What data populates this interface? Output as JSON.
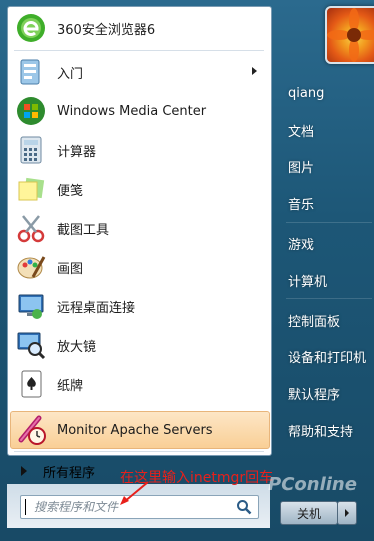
{
  "left_menu": {
    "items": [
      {
        "label": "360安全浏览器6",
        "icon": "browser-360-icon"
      },
      {
        "label": "入门",
        "icon": "getting-started-icon",
        "has_submenu": true
      },
      {
        "label": "Windows Media Center",
        "icon": "windows-media-center-icon"
      },
      {
        "label": "计算器",
        "icon": "calculator-icon"
      },
      {
        "label": "便笺",
        "icon": "sticky-notes-icon"
      },
      {
        "label": "截图工具",
        "icon": "snipping-tool-icon"
      },
      {
        "label": "画图",
        "icon": "paint-icon"
      },
      {
        "label": "远程桌面连接",
        "icon": "remote-desktop-icon"
      },
      {
        "label": "放大镜",
        "icon": "magnifier-icon"
      },
      {
        "label": "纸牌",
        "icon": "solitaire-icon"
      },
      {
        "label": "Monitor Apache Servers",
        "icon": "apache-monitor-icon",
        "highlighted": true
      }
    ],
    "all_programs_label": "所有程序"
  },
  "search": {
    "placeholder": "搜索程序和文件"
  },
  "annotation": {
    "text": "在这里输入inetmgr回车",
    "color": "#e8201b"
  },
  "right_menu": {
    "user_name": "qiang",
    "items": [
      "文档",
      "图片",
      "音乐",
      "游戏",
      "计算机",
      "控制面板",
      "设备和打印机",
      "默认程序",
      "帮助和支持"
    ],
    "shutdown_label": "关机"
  },
  "watermark": {
    "text": "PConline"
  }
}
